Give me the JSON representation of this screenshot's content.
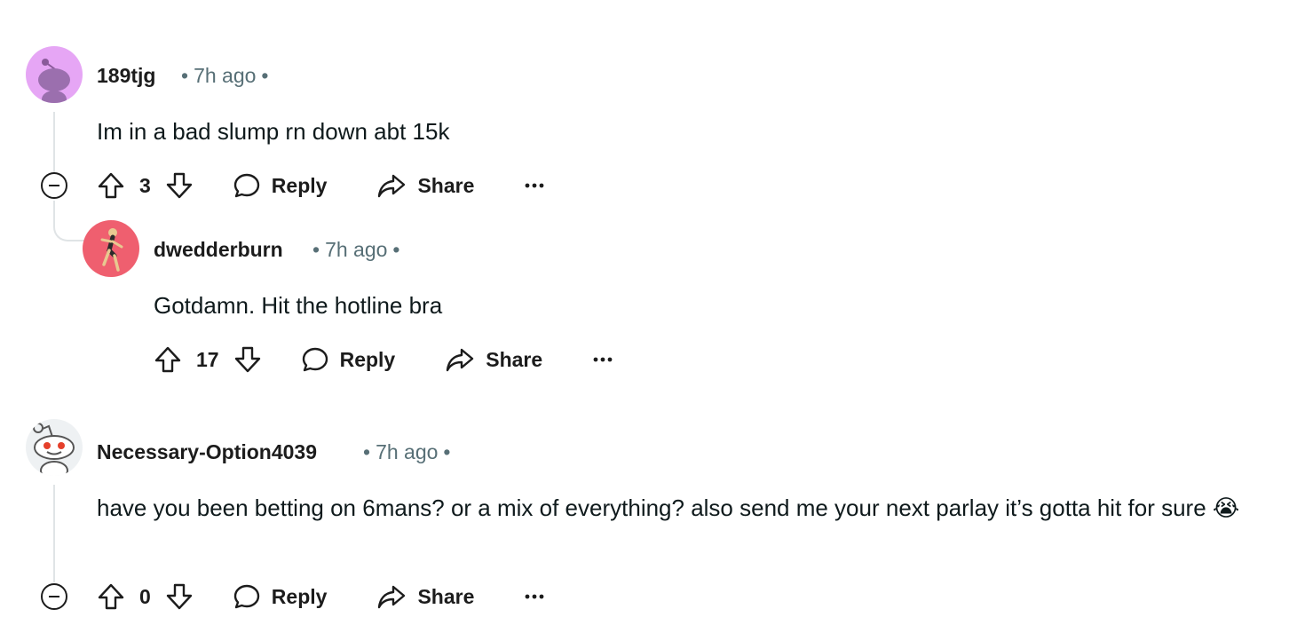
{
  "comments": [
    {
      "username": "189tjg",
      "time": "7h ago",
      "body": "Im in a bad slump rn down abt 15k",
      "score": "3",
      "reply_label": "Reply",
      "share_label": "Share"
    },
    {
      "username": "dwedderburn",
      "time": "7h ago",
      "body": "Gotdamn. Hit the hotline bra",
      "score": "17",
      "reply_label": "Reply",
      "share_label": "Share"
    },
    {
      "username": "Necessary-Option4039",
      "time": "7h ago",
      "body": "have you been betting on 6mans? or a mix of everything? also send me your next parlay it’s gotta hit for sure 😭",
      "score": "0",
      "reply_label": "Reply",
      "share_label": "Share"
    }
  ],
  "meta_separator": "•",
  "colors": {
    "text": "#0f1a1c",
    "muted": "#576f76",
    "thread_line": "#e0e4e6",
    "avatar_purple": "#e6a6f5",
    "avatar_red": "#ef5f6f"
  }
}
